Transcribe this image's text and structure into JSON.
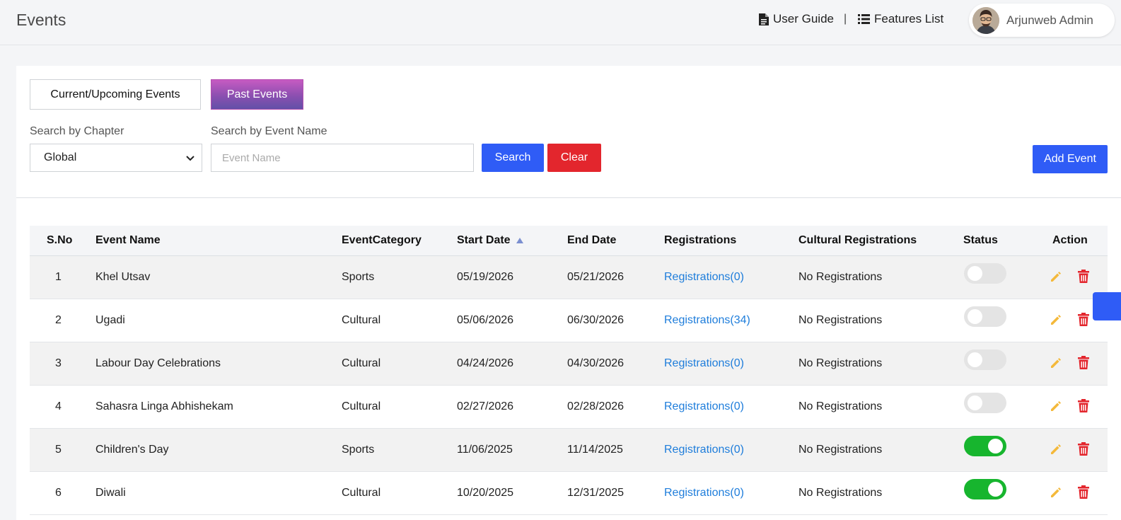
{
  "header": {
    "title": "Events",
    "user_guide": "User Guide",
    "separator": "|",
    "features_list": "Features List",
    "user_name": "Arjunweb Admin"
  },
  "tabs": {
    "current": "Current/Upcoming Events",
    "past": "Past Events"
  },
  "filters": {
    "chapter_label": "Search by Chapter",
    "chapter_value": "Global",
    "event_name_label": "Search by Event Name",
    "event_name_placeholder": "Event Name",
    "search_button": "Search",
    "clear_button": "Clear",
    "add_button": "Add Event"
  },
  "table": {
    "columns": [
      "S.No",
      "Event Name",
      "EventCategory",
      "Start Date",
      "End Date",
      "Registrations",
      "Cultural Registrations",
      "Status",
      "Action"
    ],
    "rows": [
      {
        "sno": "1",
        "name": "Khel Utsav",
        "category": "Sports",
        "start": "05/19/2026",
        "end": "05/21/2026",
        "registrations": "Registrations(0)",
        "cultural": "No Registrations",
        "status": false
      },
      {
        "sno": "2",
        "name": "Ugadi",
        "category": "Cultural",
        "start": "05/06/2026",
        "end": "06/30/2026",
        "registrations": "Registrations(34)",
        "cultural": "No Registrations",
        "status": false
      },
      {
        "sno": "3",
        "name": "Labour Day Celebrations",
        "category": "Cultural",
        "start": "04/24/2026",
        "end": "04/30/2026",
        "registrations": "Registrations(0)",
        "cultural": "No Registrations",
        "status": false
      },
      {
        "sno": "4",
        "name": "Sahasra Linga Abhishekam",
        "category": "Cultural",
        "start": "02/27/2026",
        "end": "02/28/2026",
        "registrations": "Registrations(0)",
        "cultural": "No Registrations",
        "status": false
      },
      {
        "sno": "5",
        "name": "Children's Day",
        "category": "Sports",
        "start": "11/06/2025",
        "end": "11/14/2025",
        "registrations": "Registrations(0)",
        "cultural": "No Registrations",
        "status": true
      },
      {
        "sno": "6",
        "name": "Diwali",
        "category": "Cultural",
        "start": "10/20/2025",
        "end": "12/31/2025",
        "registrations": "Registrations(0)",
        "cultural": "No Registrations",
        "status": true
      }
    ]
  },
  "icons": {
    "user_guide": "document-icon",
    "features_list": "list-icon",
    "edit": "pencil-icon",
    "delete": "trash-icon",
    "select": "chevron-down-icon",
    "sort": "sort-ascending-icon"
  },
  "colors": {
    "primary": "#2f5cf6",
    "danger": "#e3262d",
    "link": "#1e7ddb",
    "toggle_on": "#17b52e",
    "toggle_off": "#e4e4e4",
    "edit_icon": "#f4b93b",
    "delete_icon": "#e3262d"
  }
}
